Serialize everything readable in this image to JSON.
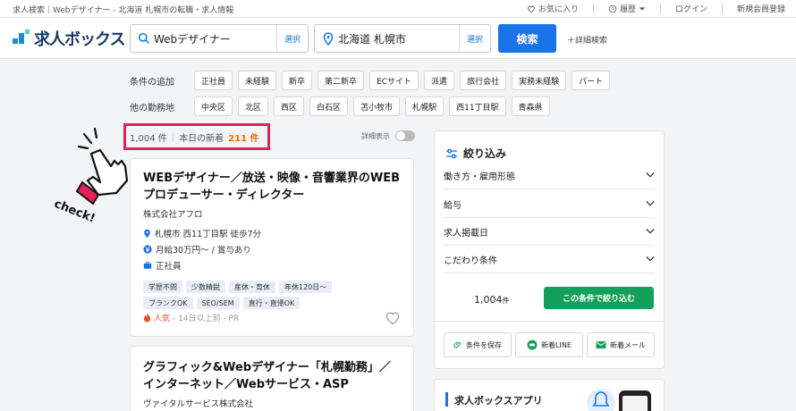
{
  "topbar": {
    "tagline": "求人検索｜Webデザイナー - 北海道 札幌市の転職・求人情報",
    "favorites": "お気に入り",
    "history": "履歴",
    "login": "ログイン",
    "register": "新規会員登録"
  },
  "header": {
    "logo": "求人ボックス",
    "keyword": "Webデザイナー",
    "keyword_select": "選択",
    "location": "北海道 札幌市",
    "location_select": "選択",
    "search_button": "検索",
    "detail_search": "＋詳細検索"
  },
  "filters": {
    "conditions_label": "条件の追加",
    "conditions": [
      "正社員",
      "未経験",
      "新卒",
      "第二新卒",
      "ECサイト",
      "派遣",
      "旅行会社",
      "実務未経験",
      "パート"
    ],
    "locations_label": "他の勤務地",
    "locations": [
      "中央区",
      "北区",
      "西区",
      "白石区",
      "苫小牧市",
      "札幌駅",
      "西11丁目駅",
      "青森県"
    ]
  },
  "results": {
    "total": "1,004 件",
    "new_label": "本日の新着",
    "new_count": "211 件",
    "detail_view": "詳細表示"
  },
  "jobs": [
    {
      "title": "WEBデザイナー／放送・映像・音響業界のWEBプロデューサー・ディレクター",
      "company": "株式会社アフロ",
      "location": "札幌市 西11丁目駅 徒歩7分",
      "salary": "月給30万円〜 / 賞与あり",
      "employment": "正社員",
      "tags": [
        "学歴不問",
        "少数精鋭",
        "産休・育休",
        "年休120日〜",
        "ブランクOK",
        "SEO/SEM",
        "直行・直帰OK"
      ],
      "popular": "人気",
      "posted": "- 14日以上前 - PR"
    },
    {
      "title": "グラフィック&Webデザイナー「札幌勤務」／インターネット／Webサービス・ASP",
      "company": "ヴァイタルサービス株式会社"
    }
  ],
  "panel": {
    "title": "絞り込み",
    "items": [
      "働き方・雇用形態",
      "給与",
      "求人掲載日",
      "こだわり条件"
    ],
    "total": "1,004",
    "total_unit": "件",
    "apply": "この条件で絞り込む",
    "save": "条件を保存",
    "line": "新着LINE",
    "mail": "新着メール"
  },
  "app": {
    "title": "求人ボックスアプリ"
  },
  "annotation": {
    "check": "check!"
  },
  "colors": {
    "accent": "#1a73e8",
    "highlight": "#e61f5b",
    "apply": "#14a05a",
    "new": "#f07000"
  }
}
